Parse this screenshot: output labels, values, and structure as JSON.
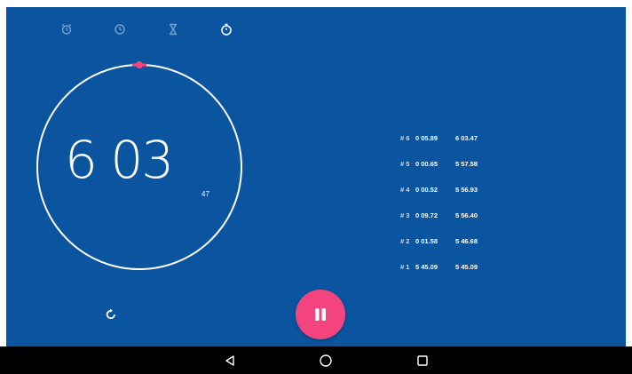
{
  "tabs": [
    {
      "icon": "alarm-icon",
      "active": false
    },
    {
      "icon": "clock-icon",
      "active": false
    },
    {
      "icon": "timer-icon",
      "active": false
    },
    {
      "icon": "stopwatch-icon",
      "active": true
    }
  ],
  "stopwatch": {
    "time_main": "6 03",
    "time_hundredths": "47",
    "progress_marker_color": "#f4447f"
  },
  "laps": [
    {
      "num": "# 6",
      "split": "0 05.89",
      "total": "6 03.47"
    },
    {
      "num": "# 5",
      "split": "0 00.65",
      "total": "5 57.58"
    },
    {
      "num": "# 4",
      "split": "0 00.52",
      "total": "5 56.93"
    },
    {
      "num": "# 3",
      "split": "0 09.72",
      "total": "5 56.40"
    },
    {
      "num": "# 2",
      "split": "0 01.58",
      "total": "5 46.68"
    },
    {
      "num": "# 1",
      "split": "5 45.09",
      "total": "5 45.09"
    }
  ],
  "controls": {
    "reset_icon": "reset-icon",
    "pause_icon": "pause-icon",
    "fab_color": "#f4447f"
  },
  "navbar": {
    "back_icon": "back-icon",
    "home_icon": "home-icon",
    "recents_icon": "recents-icon"
  },
  "colors": {
    "background": "#0b55a0",
    "accent": "#f4447f"
  }
}
